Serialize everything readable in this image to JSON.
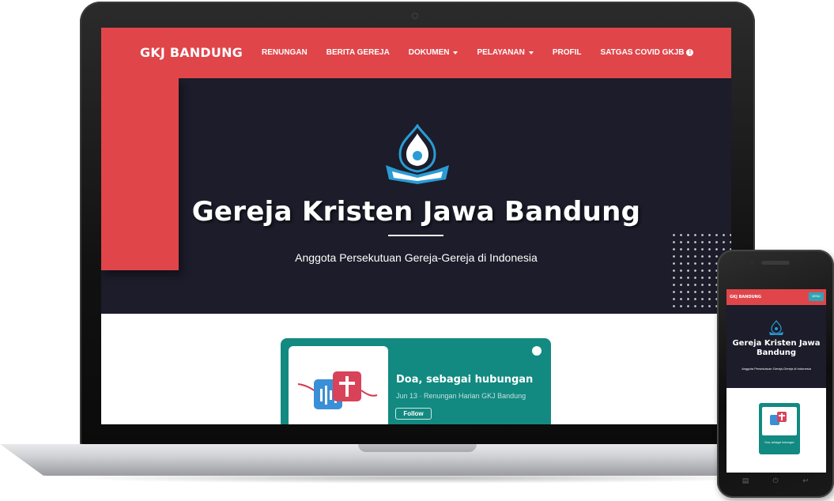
{
  "site": {
    "brand": "GKJ BANDUNG",
    "nav": [
      {
        "label": "RENUNGAN",
        "dropdown": false
      },
      {
        "label": "BERITA GEREJA",
        "dropdown": false
      },
      {
        "label": "DOKUMEN",
        "dropdown": true
      },
      {
        "label": "PELAYANAN",
        "dropdown": true
      },
      {
        "label": "PROFIL",
        "dropdown": false
      },
      {
        "label": "SATGAS COVID GKJB",
        "dropdown": false,
        "info_icon": true
      }
    ],
    "hero": {
      "title": "Gereja Kristen Jawa Bandung",
      "subtitle": "Anggota Persekutuan Gereja-Gereja di Indonesia"
    },
    "podcast": {
      "title": "Doa, sebagai hubungan",
      "subtitle": "Jun 13 · Renungan Harian GKJ Bandung",
      "follow_label": "Follow",
      "spotify_icon": "spotify-icon"
    }
  },
  "mobile": {
    "brand": "GKJ BANDUNG",
    "toggle_label": "MENU",
    "hero_title": "Gereja Kristen Jawa Bandung",
    "hero_subtitle": "Anggota Persekutuan Gereja-Gereja di Indonesia",
    "card_text": "Doa, sebagai hubungan"
  },
  "colors": {
    "brand_red": "#e0454a",
    "hero_dark": "#1c1c2a",
    "podcast_teal": "#128a81",
    "logo_blue": "#2a9bd4"
  }
}
